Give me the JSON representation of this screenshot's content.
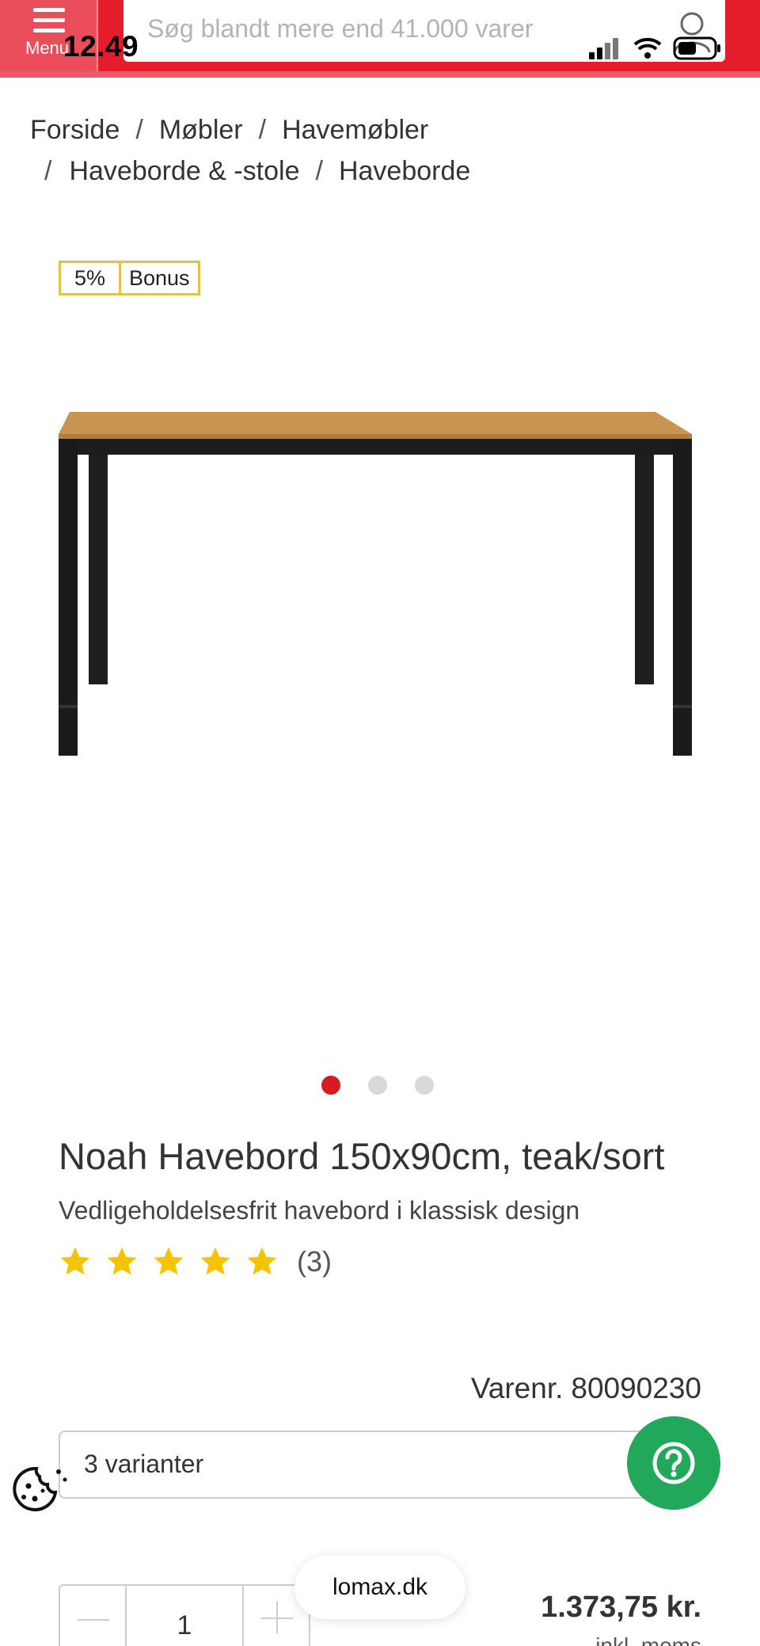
{
  "status_bar": {
    "time": "12.49"
  },
  "header": {
    "menu_label": "Menu",
    "search_placeholder": "Søg blandt mere end 41.000 varer",
    "brand_color": "#e41c2c"
  },
  "breadcrumb": {
    "items": [
      "Forside",
      "Møbler",
      "Havemøbler",
      "Haveborde & -stole",
      "Haveborde"
    ],
    "separator": "/"
  },
  "bonus_badge": {
    "percent": "5%",
    "label": "Bonus"
  },
  "carousel": {
    "total": 3,
    "active_index": 0
  },
  "product": {
    "title": "Noah Havebord 150x90cm, teak/sort",
    "subtitle": "Vedligeholdelsesfrit havebord i klassisk design",
    "rating_stars": 5,
    "review_count": "(3)",
    "sku_label": "Varenr.",
    "sku": "80090230",
    "variants": "3 varianter",
    "quantity": "1",
    "price": "1.373,75 kr.",
    "price_note": "inkl. moms"
  },
  "domain": "lomax.dk",
  "icons": {
    "menu": "hamburger-icon",
    "user": "user-icon",
    "help": "question-icon",
    "cookie": "cookie-icon",
    "star": "star-icon"
  },
  "colors": {
    "accent": "#e41c2c",
    "star": "#f5c400",
    "help": "#22a85a",
    "badge_border": "#e0c34a"
  }
}
